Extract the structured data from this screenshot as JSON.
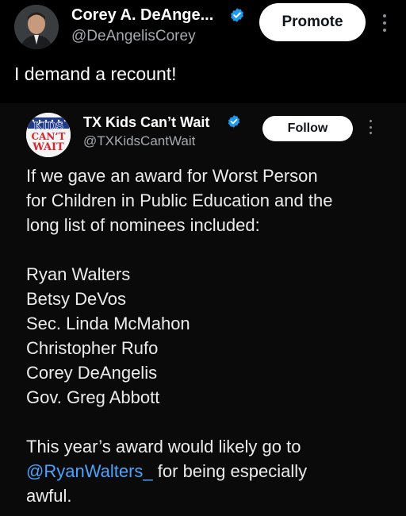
{
  "post": {
    "author_name": "Corey A. DeAnge...",
    "author_handle": "@DeAngelisCorey",
    "promote_label": "Promote",
    "text": "I demand a recount!"
  },
  "quoted": {
    "author_name": "TX Kids Can’t Wait",
    "author_handle": "@TXKidsCantWait",
    "follow_label": "Follow",
    "avatar_text": [
      "KIDS",
      "CAN’T",
      "WAIT"
    ],
    "intro": [
      "If we gave an award for Worst Person",
      "for Children in Public Education and the",
      "long list of nominees included:"
    ],
    "nominees": [
      "Ryan Walters",
      "Betsy DeVos",
      "Sec. Linda McMahon",
      "Christopher Rufo",
      "Corey DeAngelis",
      "Gov. Greg Abbott"
    ],
    "closing": {
      "line1": "This year’s award would likely go to",
      "mention": "@RyanWalters_",
      "after_mention": " for being especially",
      "line3": "awful."
    }
  },
  "colors": {
    "background": "#000000",
    "text": "#e7e9ea",
    "muted": "#a5aab0",
    "link": "#4aa4ff",
    "verified": "#1d9bf0"
  },
  "icons": [
    "verified-badge-icon",
    "more-options-icon"
  ]
}
